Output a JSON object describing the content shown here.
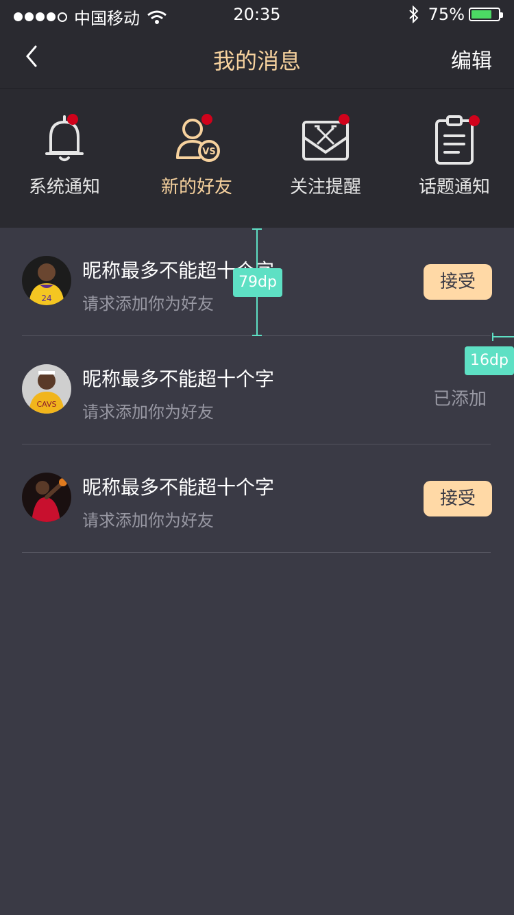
{
  "status": {
    "carrier": "中国移动",
    "time": "20:35",
    "battery": "75%",
    "battery_level": 0.75
  },
  "nav": {
    "title": "我的消息",
    "edit": "编辑"
  },
  "categories": [
    {
      "label": "系统通知",
      "icon": "bell-icon"
    },
    {
      "label": "新的好友",
      "icon": "person-vs-icon"
    },
    {
      "label": "关注提醒",
      "icon": "envelope-arrows-icon"
    },
    {
      "label": "话题通知",
      "icon": "clipboard-icon"
    }
  ],
  "requests": [
    {
      "name": "昵称最多不能超十个字",
      "sub": "请求添加你为好友",
      "action": "接受",
      "state": "pending",
      "avatar": "avatar-yellow-jersey"
    },
    {
      "name": "昵称最多不能超十个字",
      "sub": "请求添加你为好友",
      "action": "已添加",
      "state": "added",
      "avatar": "avatar-gold-jersey"
    },
    {
      "name": "昵称最多不能超十个字",
      "sub": "请求添加你为好友",
      "action": "接受",
      "state": "pending",
      "avatar": "avatar-red-jersey"
    }
  ],
  "annotations": {
    "height_tag": "79dp",
    "margin_tag": "16dp"
  },
  "colors": {
    "accent": "#f7d29e",
    "badge": "#d0021b",
    "button_bg": "#ffd9a6",
    "background": "#3a3a45",
    "header_bg": "#2a2a30"
  }
}
